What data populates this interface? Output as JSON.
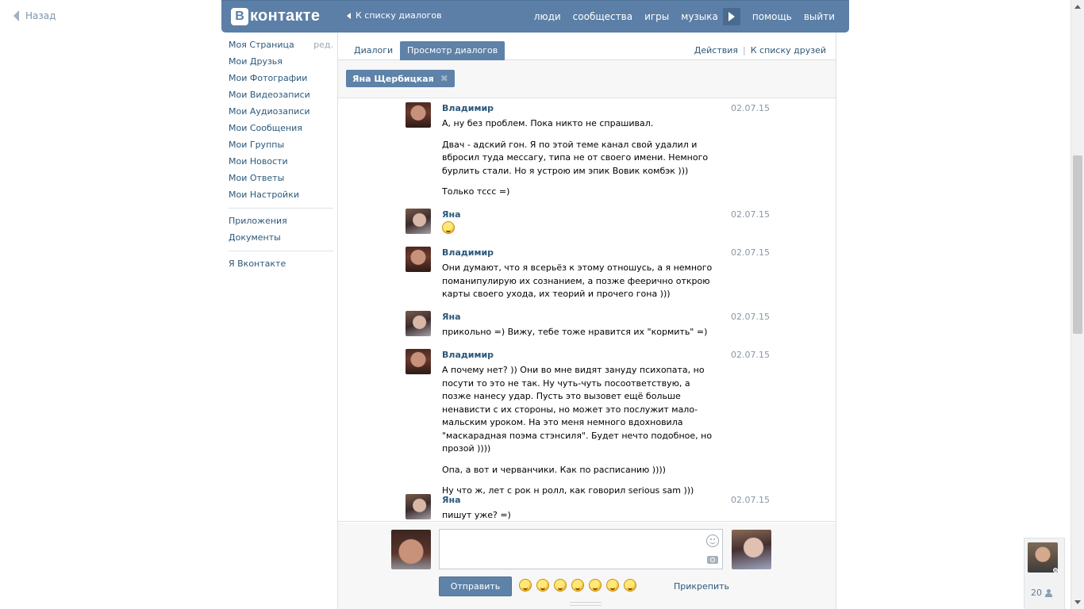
{
  "back": {
    "label": "Назад"
  },
  "header": {
    "logo_letter": "В",
    "logo_text": "контакте",
    "to_dialogs": "К списку диалогов",
    "nav": [
      "люди",
      "сообщества",
      "игры",
      "музыка",
      "помощь",
      "выйти"
    ]
  },
  "left_menu": {
    "edit_label": "ред.",
    "group1": [
      "Моя Страница",
      "Мои Друзья",
      "Мои Фотографии",
      "Мои Видеозаписи",
      "Мои Аудиозаписи",
      "Мои Сообщения",
      "Мои Группы",
      "Мои Новости",
      "Мои Ответы",
      "Мои Настройки"
    ],
    "group2": [
      "Приложения",
      "Документы"
    ],
    "group3": [
      "Я Вконтакте"
    ]
  },
  "tabs": {
    "dialogs": "Диалоги",
    "view_dialogs": "Просмотр диалогов",
    "actions": "Действия",
    "separator": "|",
    "to_friends": "К списку друзей"
  },
  "peer": {
    "name": "Яна Щербицкая",
    "remove_symbol": "✖"
  },
  "messages": [
    {
      "author": "Владимир",
      "date": "02.07.15",
      "paragraphs": [
        "А, ну без проблем. Пока никто не спрашивал.",
        "Двач - адский гон. Я по этой теме канал свой удалил и вбросил туда мессагу, типа не от своего имени. Немного бурлить стали. Но я устрою им эпик Вовик комбэк )))",
        "Только тссс =)"
      ]
    },
    {
      "author": "Яна",
      "date": "02.07.15",
      "paragraphs": []
    },
    {
      "author": "Владимир",
      "date": "02.07.15",
      "paragraphs": [
        "Они думают, что я всерьёз к этому отношусь, а я немного поманипулирую их сознанием, а позже феерично открою карты своего ухода, их теорий и прочего гона )))"
      ]
    },
    {
      "author": "Яна",
      "date": "02.07.15",
      "paragraphs": [
        "прикольно =) Вижу, тебе тоже нравится их \"кормить\" =)"
      ]
    },
    {
      "author": "Владимир",
      "date": "02.07.15",
      "paragraphs": [
        "А почему нет? )) Они во мне видят зануду психопата, но посути то это не так. Ну чуть-чуть посоответствую, а позже нанесу удар. Пусть это вызовет ещё больше ненависти с их стороны, но может это послужит мало-мальским уроком. На это меня немного вдохновила \"маскарадная поэма стэнсиля\". Будет нечто подобное, но прозой ))))",
        "Опа, а вот и черванчики. Как по расписанию ))))",
        "Ну что ж, лет с рок н ролл, как говорил serious sam )))"
      ]
    },
    {
      "author": "Яна",
      "date": "02.07.15",
      "paragraphs": [
        "пишут уже? =)"
      ]
    }
  ],
  "composer": {
    "send_label": "Отправить",
    "attach_label": "Прикрепить",
    "input_value": ""
  },
  "friends_widget": {
    "count": "20"
  },
  "icons": {
    "back": "chevron-left-icon",
    "play": "play-icon",
    "smile": "smile-icon",
    "camera": "camera-icon",
    "person": "person-icon"
  },
  "colors": {
    "brand": "#5b7fa6",
    "link": "#2b587a",
    "date": "#8a97a4"
  }
}
